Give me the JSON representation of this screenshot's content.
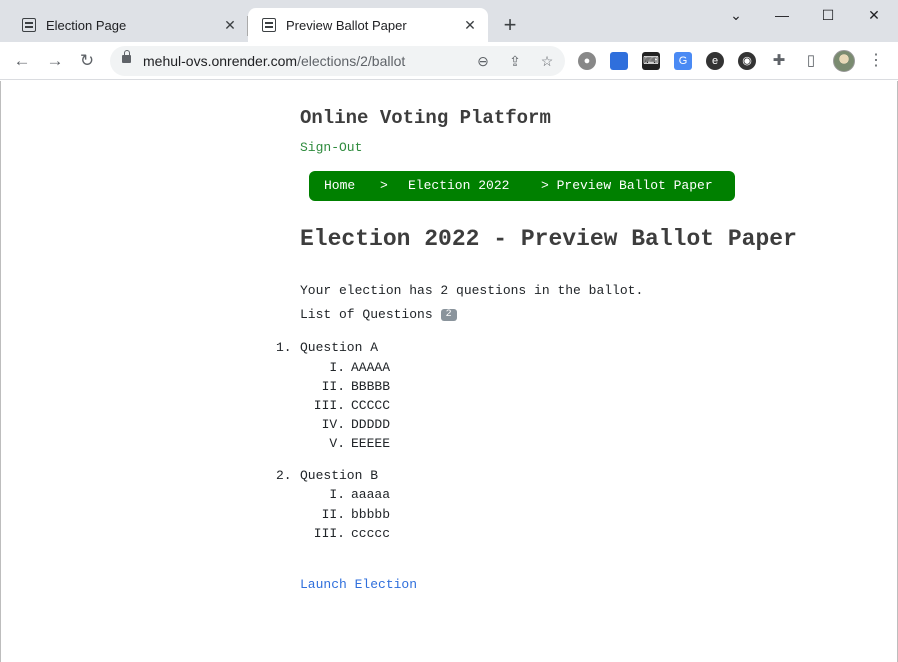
{
  "browser": {
    "tabs": [
      {
        "title": "Election Page",
        "active": false
      },
      {
        "title": "Preview Ballot Paper",
        "active": true
      }
    ],
    "url_host": "mehul-ovs.onrender.com",
    "url_path": "/elections/2/ballot",
    "icons": {
      "back": "arrow-left-icon",
      "forward": "arrow-right-icon",
      "reload": "reload-icon",
      "zoom": "zoom-icon",
      "share": "share-icon",
      "bookmark": "star-icon",
      "extensions": "puzzle-icon",
      "menu": "three-dots-icon"
    }
  },
  "page": {
    "brand": "Online Voting Platform",
    "sign_out": "Sign-Out",
    "breadcrumb": {
      "home": "Home",
      "sep": ">",
      "election": "Election 2022",
      "current": "> Preview Ballot Paper"
    },
    "heading": "Election 2022 - Preview Ballot Paper",
    "summary": "Your election has 2 questions in the ballot.",
    "list_label": "List of Questions",
    "question_count": "2",
    "questions": [
      {
        "num": "1.",
        "title": "Question A",
        "options": [
          {
            "num": "I.",
            "text": "AAAAA"
          },
          {
            "num": "II.",
            "text": "BBBBB"
          },
          {
            "num": "III.",
            "text": "CCCCC"
          },
          {
            "num": "IV.",
            "text": "DDDDD"
          },
          {
            "num": "V.",
            "text": "EEEEE"
          }
        ]
      },
      {
        "num": "2.",
        "title": "Question B",
        "options": [
          {
            "num": "I.",
            "text": "aaaaa"
          },
          {
            "num": "II.",
            "text": "bbbbb"
          },
          {
            "num": "III.",
            "text": "ccccc"
          }
        ]
      }
    ],
    "launch": "Launch Election"
  },
  "colors": {
    "breadcrumb_bg": "#008000",
    "link_green": "#2e8b3d",
    "link_blue": "#2f6fdc"
  }
}
